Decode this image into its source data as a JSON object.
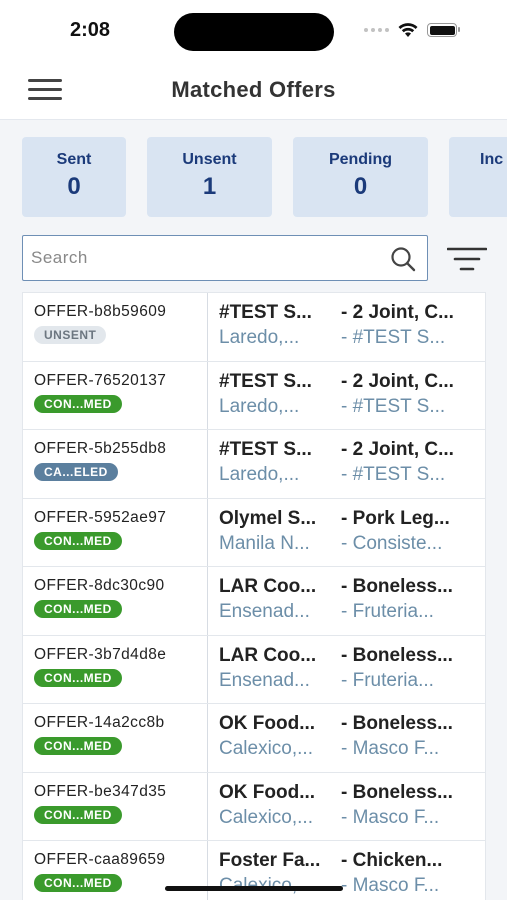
{
  "status_bar": {
    "time": "2:08"
  },
  "header": {
    "title": "Matched Offers"
  },
  "stats": [
    {
      "label": "Sent",
      "value": "0"
    },
    {
      "label": "Unsent",
      "value": "1"
    },
    {
      "label": "Pending",
      "value": "0"
    },
    {
      "label": "Inc",
      "value": ""
    }
  ],
  "search": {
    "placeholder": "Search",
    "value": ""
  },
  "offers": [
    {
      "id": "OFFER-b8b59609",
      "status": "UNSENT",
      "col1_top": "#TEST S...",
      "col2_top": "- 2 Joint, C...",
      "col1_bottom": "Laredo,...",
      "col2_bottom": "- #TEST S..."
    },
    {
      "id": "OFFER-76520137",
      "status": "CON...MED",
      "col1_top": "#TEST S...",
      "col2_top": "- 2 Joint, C...",
      "col1_bottom": "Laredo,...",
      "col2_bottom": "- #TEST S..."
    },
    {
      "id": "OFFER-5b255db8",
      "status": "CA...ELED",
      "col1_top": "#TEST S...",
      "col2_top": "- 2 Joint, C...",
      "col1_bottom": "Laredo,...",
      "col2_bottom": "- #TEST S..."
    },
    {
      "id": "OFFER-5952ae97",
      "status": "CON...MED",
      "col1_top": "Olymel S...",
      "col2_top": "- Pork Leg...",
      "col1_bottom": "Manila N...",
      "col2_bottom": "- Consiste..."
    },
    {
      "id": "OFFER-8dc30c90",
      "status": "CON...MED",
      "col1_top": "LAR Coo...",
      "col2_top": "- Boneless...",
      "col1_bottom": "Ensenad...",
      "col2_bottom": "- Fruteria..."
    },
    {
      "id": "OFFER-3b7d4d8e",
      "status": "CON...MED",
      "col1_top": "LAR Coo...",
      "col2_top": "- Boneless...",
      "col1_bottom": "Ensenad...",
      "col2_bottom": "- Fruteria..."
    },
    {
      "id": "OFFER-14a2cc8b",
      "status": "CON...MED",
      "col1_top": "OK Food...",
      "col2_top": "- Boneless...",
      "col1_bottom": "Calexico,...",
      "col2_bottom": "- Masco F..."
    },
    {
      "id": "OFFER-be347d35",
      "status": "CON...MED",
      "col1_top": "OK Food...",
      "col2_top": "- Boneless...",
      "col1_bottom": "Calexico,...",
      "col2_bottom": "- Masco F..."
    },
    {
      "id": "OFFER-caa89659",
      "status": "CON...MED",
      "col1_top": "Foster Fa...",
      "col2_top": "- Chicken...",
      "col1_bottom": "Calexico,...",
      "col2_bottom": "- Masco F..."
    }
  ],
  "colors": {
    "stat_card_bg": "#d9e4f2",
    "stat_text": "#1b3a7a",
    "confirmed": "#3a9a2c",
    "cancelled": "#5b7f9e",
    "unsent": "#e2e7ec",
    "secondary_text": "#6c8ea8"
  },
  "icons": [
    "hamburger-menu-icon",
    "search-icon",
    "filter-icon",
    "wifi-icon",
    "battery-icon",
    "signal-icon"
  ]
}
